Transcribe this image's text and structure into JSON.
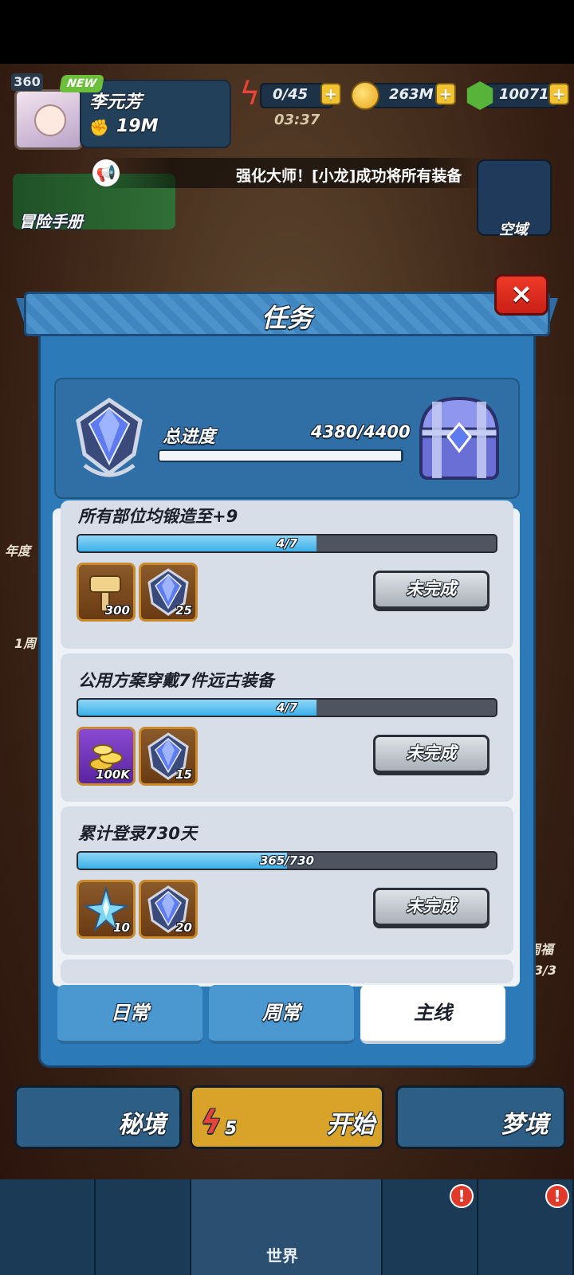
{
  "hud": {
    "level": "360",
    "new_tag": "NEW",
    "player_name": "李元芳",
    "power": "19M",
    "energy": "0/45",
    "energy_timer": "03:37",
    "coins": "263M",
    "gems": "10071",
    "plus": "+"
  },
  "broadcast": {
    "text": "强化大师！[小龙]成功将所有装备"
  },
  "side": {
    "adventure_book": "冒险手册",
    "sky_realm": "空域",
    "annual": "年度",
    "week": "1周",
    "blessing": "周福",
    "blessing_count": "3/3"
  },
  "modal": {
    "title": "任务",
    "close": "×",
    "total_label": "总进度",
    "total_value": "4380/4400",
    "total_progress": 0.9955
  },
  "quests": [
    {
      "title": "所有部位均锻造至+9",
      "progress_text": "4/7",
      "progress": 0.571,
      "rewards": [
        {
          "icon": "hammer-icon",
          "count": "300"
        },
        {
          "icon": "crystal-emblem-icon",
          "count": "25"
        }
      ],
      "status": "未完成"
    },
    {
      "title": "公用方案穿戴7件远古装备",
      "progress_text": "4/7",
      "progress": 0.571,
      "rewards": [
        {
          "icon": "gold-coins-icon",
          "count": "100K"
        },
        {
          "icon": "crystal-emblem-icon",
          "count": "15"
        }
      ],
      "status": "未完成"
    },
    {
      "title": "累计登录730天",
      "progress_text": "365/730",
      "progress": 0.5,
      "rewards": [
        {
          "icon": "star-crystal-icon",
          "count": "10"
        },
        {
          "icon": "crystal-emblem-icon",
          "count": "20"
        }
      ],
      "status": "未完成"
    }
  ],
  "tabs": [
    {
      "label": "日常",
      "active": false
    },
    {
      "label": "周常",
      "active": false
    },
    {
      "label": "主线",
      "active": true
    }
  ],
  "bottom": {
    "secret": "秘境",
    "start": "开始",
    "start_cost": "5",
    "dream": "梦境",
    "world": "世界",
    "alert": "!"
  },
  "colors": {
    "panel_blue": "#2d7ab8",
    "progress_cyan": "#3bb0e8",
    "close_red": "#e23a2a"
  }
}
